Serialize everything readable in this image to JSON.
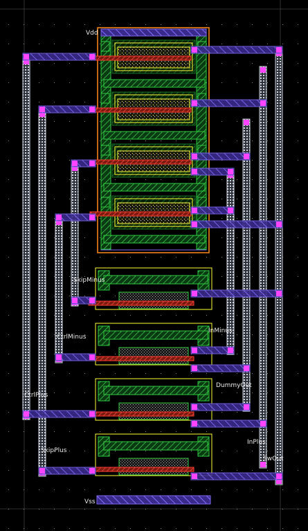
{
  "layout_view": {
    "pin_labels": {
      "vdd_top": "Vdd",
      "vss_bottom": "Vss",
      "skip_minus": "SkipMinus",
      "ctrl_minus": "CtrlMinus",
      "in_minus": "InMinus",
      "dummy_out": "DummyOut",
      "ctrl_plus": "CtrlPlus",
      "skip_plus": "SkipPlus",
      "in_plus": "InPlus",
      "sw_out": "SwOut"
    },
    "colors": {
      "background": "#000000",
      "grid": "#ffffff",
      "metal1_outline": "#7b68ee",
      "metal2_fill": "#4b2fa8",
      "poly": "#ff3b2f",
      "active": "#2ecc40",
      "implant": "#ffff33",
      "contact": "#ff44ff",
      "nwell": "#ff8c1a",
      "via_stack": "#cfd8e3"
    }
  }
}
